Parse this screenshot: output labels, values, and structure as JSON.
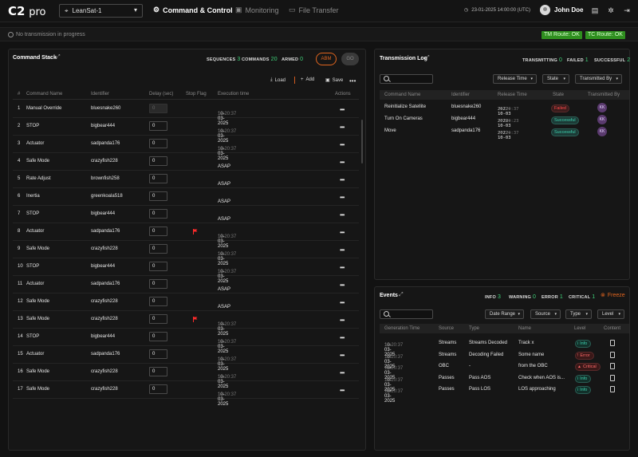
{
  "app": {
    "logo_bold": "C2",
    "logo_light": "pro"
  },
  "header": {
    "satellite": "LeanSat-1",
    "nav": [
      {
        "label": "Command & Control",
        "icon": "command-icon",
        "active": true
      },
      {
        "label": "Monitoring",
        "icon": "monitoring-icon",
        "active": false
      },
      {
        "label": "File Transfer",
        "icon": "folder-icon",
        "active": false
      }
    ],
    "datetime": "23-01-2025 14:00:00 (UTC)",
    "user": "John Doe"
  },
  "status": {
    "message": "No transmission in progress",
    "tm_route": "TM Route: OK",
    "tc_route": "TC Route: OK",
    "route_color": "#2f8f1f"
  },
  "command_stack": {
    "title": "Command Stack",
    "sequences_label": "SEQUENCES",
    "sequences": "3",
    "commands_label": "COMMANDS",
    "commands": "20",
    "armed_label": "ARMED",
    "armed": "0",
    "abm": "ABM",
    "go": "GO",
    "load": "Load",
    "add": "Add",
    "save": "Save",
    "columns": [
      "#",
      "Command Name",
      "Identifier",
      "Delay (sec)",
      "Stop Flag",
      "Execution time",
      "Actions"
    ],
    "rows": [
      {
        "n": "1",
        "name": "Manual Override",
        "id": "bluesnake260",
        "delay": "0",
        "disabled": true,
        "flag": false,
        "date": "10-03-2025",
        "time": "12:20:37"
      },
      {
        "n": "2",
        "name": "STOP",
        "id": "bigbear444",
        "delay": "0",
        "disabled": false,
        "flag": false,
        "date": "10-03-2025",
        "time": "12:20:37"
      },
      {
        "n": "3",
        "name": "Actuator",
        "id": "sadpanda176",
        "delay": "0",
        "disabled": false,
        "flag": false,
        "date": "10-03-2025",
        "time": "12:20:37"
      },
      {
        "n": "4",
        "name": "Safe Mode",
        "id": "crazyfish228",
        "delay": "0",
        "disabled": false,
        "flag": false,
        "date": "ASAP",
        "time": ""
      },
      {
        "n": "5",
        "name": "Rate Adjust",
        "id": "brownfish258",
        "delay": "0",
        "disabled": false,
        "flag": false,
        "date": "ASAP",
        "time": ""
      },
      {
        "n": "6",
        "name": "Inertia",
        "id": "greenkoala518",
        "delay": "0",
        "disabled": false,
        "flag": false,
        "date": "ASAP",
        "time": ""
      },
      {
        "n": "7",
        "name": "STOP",
        "id": "bigbear444",
        "delay": "0",
        "disabled": false,
        "flag": false,
        "date": "ASAP",
        "time": ""
      },
      {
        "n": "8",
        "name": "Actuator",
        "id": "sadpanda176",
        "delay": "0",
        "disabled": false,
        "flag": true,
        "date": "10-03-2025",
        "time": "12:20:37"
      },
      {
        "n": "9",
        "name": "Safe Mode",
        "id": "crazyfish228",
        "delay": "0",
        "disabled": false,
        "flag": false,
        "date": "10-03-2025",
        "time": "12:20:37"
      },
      {
        "n": "10",
        "name": "STOP",
        "id": "bigbear444",
        "delay": "0",
        "disabled": false,
        "flag": false,
        "date": "10-03-2025",
        "time": "12:20:37"
      },
      {
        "n": "11",
        "name": "Actuator",
        "id": "sadpanda176",
        "delay": "0",
        "disabled": false,
        "flag": false,
        "date": "ASAP",
        "time": ""
      },
      {
        "n": "12",
        "name": "Safe Mode",
        "id": "crazyfish228",
        "delay": "0",
        "disabled": false,
        "flag": false,
        "date": "ASAP",
        "time": ""
      },
      {
        "n": "13",
        "name": "Safe Mode",
        "id": "crazyfish228",
        "delay": "0",
        "disabled": false,
        "flag": true,
        "date": "10-03-2025",
        "time": "12:20:37"
      },
      {
        "n": "14",
        "name": "STOP",
        "id": "bigbear444",
        "delay": "0",
        "disabled": false,
        "flag": false,
        "date": "10-03-2025",
        "time": "12:20:37"
      },
      {
        "n": "15",
        "name": "Actuator",
        "id": "sadpanda176",
        "delay": "0",
        "disabled": false,
        "flag": false,
        "date": "10-03-2025",
        "time": "12:20:37"
      },
      {
        "n": "16",
        "name": "Safe Mode",
        "id": "crazyfish228",
        "delay": "0",
        "disabled": false,
        "flag": false,
        "date": "10-03-2025",
        "time": "12:20:37"
      },
      {
        "n": "17",
        "name": "Safe Mode",
        "id": "crazyfish228",
        "delay": "0",
        "disabled": false,
        "flag": false,
        "date": "10-03-2025",
        "time": "12:20:37"
      }
    ]
  },
  "transmission_log": {
    "title": "Transmission Log",
    "transmitting_label": "TRANSMITTING",
    "transmitting": "0",
    "failed_label": "FAILED",
    "failed": "1",
    "successful_label": "SUCCESSFUL",
    "successful": "2",
    "filters": [
      "Release Time",
      "State",
      "Transmitted By"
    ],
    "columns": [
      "Command Name",
      "Identifier",
      "Release Time",
      "State",
      "Transmitted By"
    ],
    "rows": [
      {
        "name": "Reinitialize Satellite",
        "id": "bluesnake260",
        "date": "2022-10-03",
        "time": "12:20:37",
        "state": "Failed",
        "by": "KK"
      },
      {
        "name": "Turn On Cameras",
        "id": "bigbear444",
        "date": "2022-10-03",
        "time": "15:00:23",
        "state": "Successful",
        "by": "KK"
      },
      {
        "name": "Move",
        "id": "sadpanda176",
        "date": "2022-10-03",
        "time": "16:20:37",
        "state": "Successful",
        "by": "KK"
      }
    ]
  },
  "events": {
    "title": "Events",
    "info_label": "INFO",
    "info": "3",
    "warning_label": "WARNING",
    "warning": "0",
    "error_label": "ERROR",
    "error": "1",
    "critical_label": "CRITICAL",
    "critical": "1",
    "freeze": "Freeze",
    "filters": [
      "Date Range",
      "Source",
      "Type",
      "Level"
    ],
    "columns": [
      "Generation Time",
      "Source",
      "Type",
      "Name",
      "Level",
      "Content"
    ],
    "rows": [
      {
        "date": "10-03-2025",
        "time": "12:20:37",
        "source": "Streams",
        "type": "Streams Decoded",
        "name": "Track x",
        "level": "Info"
      },
      {
        "date": "10-03-2025",
        "time": "12:20:37",
        "source": "Streams",
        "type": "Decoding Failed",
        "name": "Some name",
        "level": "Error"
      },
      {
        "date": "10-03-2025",
        "time": "12:20:37",
        "source": "OBC",
        "type": "-",
        "name": "from the OBC",
        "level": "Critical"
      },
      {
        "date": "10-03-2025",
        "time": "12:20:37",
        "source": "Passes",
        "type": "Pass AOS",
        "name": "Check when AOS is...",
        "level": "Info"
      },
      {
        "date": "10-03-2025",
        "time": "12:20:37",
        "source": "Passes",
        "type": "Pass LOS",
        "name": "LOS approaching",
        "level": "Info"
      }
    ]
  }
}
